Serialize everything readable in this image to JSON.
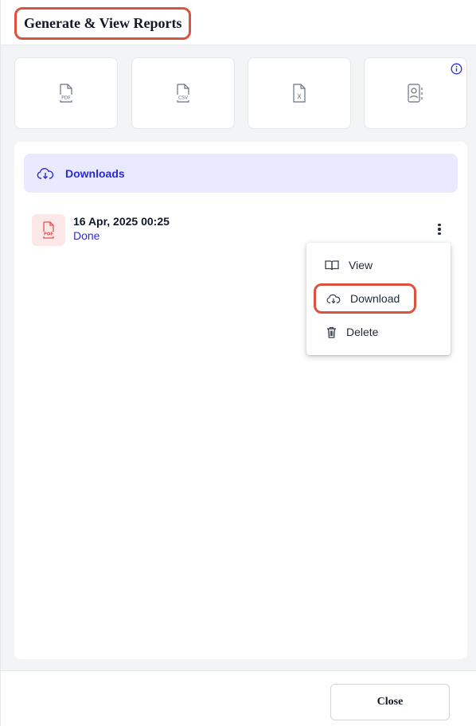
{
  "header": {
    "title": "Generate & View Reports"
  },
  "report_types": [
    {
      "icon": "pdf-file-icon",
      "label": "PDF"
    },
    {
      "icon": "csv-file-icon",
      "label": "CSV"
    },
    {
      "icon": "excel-file-icon",
      "label": "X"
    },
    {
      "icon": "contact-report-icon"
    }
  ],
  "info_icon": "info-icon",
  "downloads": {
    "tab_label": "Downloads",
    "files": [
      {
        "icon": "pdf-file-icon",
        "badge_text": "PDF",
        "date": "16 Apr, 2025 00:25",
        "status": "Done"
      }
    ]
  },
  "context_menu": {
    "items": [
      {
        "label": "View",
        "icon": "book-open-icon"
      },
      {
        "label": "Download",
        "icon": "cloud-download-icon"
      },
      {
        "label": "Delete",
        "icon": "trash-icon"
      }
    ]
  },
  "footer": {
    "close_label": "Close"
  },
  "colors": {
    "accent": "#2b2bd6",
    "highlight": "#d9533f",
    "downloads_tab_bg": "#e9e9ff",
    "pdf_red": "#e05252"
  }
}
